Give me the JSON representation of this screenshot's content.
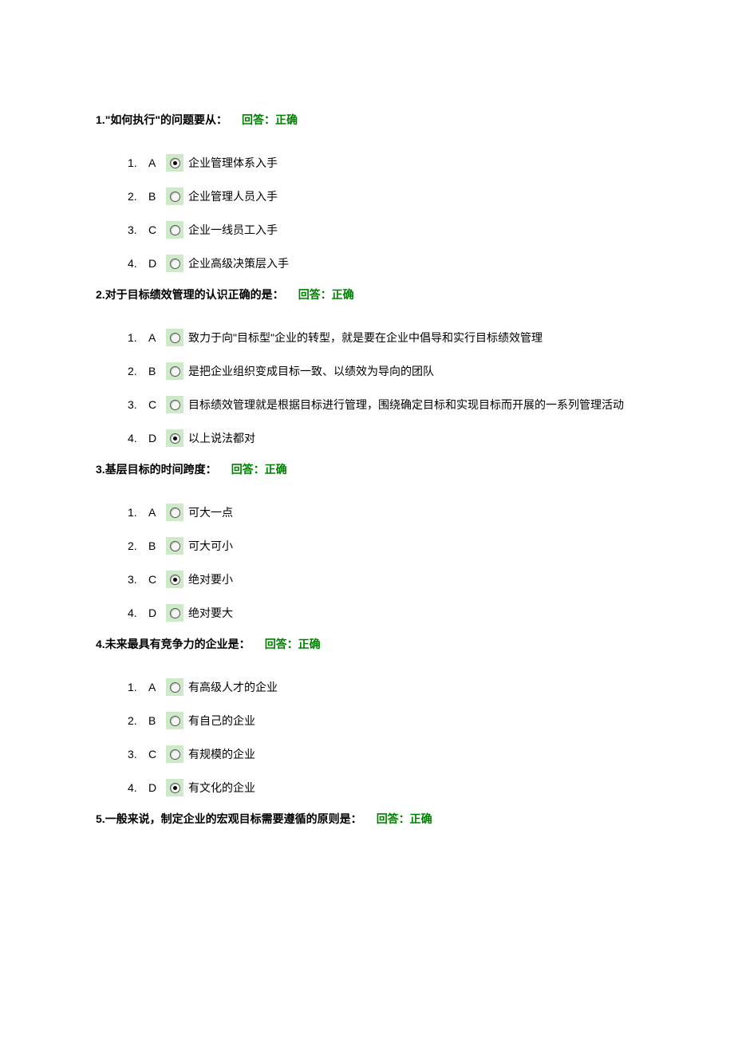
{
  "answer_label": "回答：正确",
  "questions": [
    {
      "num": "1.",
      "stem": "\"如何执行\"的问题要从：",
      "selected": 0,
      "options": [
        {
          "letter": "A",
          "text": "企业管理体系入手"
        },
        {
          "letter": "B",
          "text": "企业管理人员入手"
        },
        {
          "letter": "C",
          "text": "企业一线员工入手"
        },
        {
          "letter": "D",
          "text": "企业高级决策层入手"
        }
      ]
    },
    {
      "num": "2.",
      "stem": "对于目标绩效管理的认识正确的是：",
      "selected": 3,
      "options": [
        {
          "letter": "A",
          "text": "致力于向\"目标型\"企业的转型，就是要在企业中倡导和实行目标绩效管理"
        },
        {
          "letter": "B",
          "text": "是把企业组织变成目标一致、以绩效为导向的团队"
        },
        {
          "letter": "C",
          "text": "目标绩效管理就是根据目标进行管理，围绕确定目标和实现目标而开展的一系列管理活动"
        },
        {
          "letter": "D",
          "text": "以上说法都对"
        }
      ]
    },
    {
      "num": "3.",
      "stem": "基层目标的时间跨度：",
      "selected": 2,
      "options": [
        {
          "letter": "A",
          "text": "可大一点"
        },
        {
          "letter": "B",
          "text": "可大可小"
        },
        {
          "letter": "C",
          "text": "绝对要小"
        },
        {
          "letter": "D",
          "text": "绝对要大"
        }
      ]
    },
    {
      "num": "4.",
      "stem": "未来最具有竞争力的企业是：",
      "selected": 3,
      "options": [
        {
          "letter": "A",
          "text": "有高级人才的企业"
        },
        {
          "letter": "B",
          "text": "有自己的企业"
        },
        {
          "letter": "C",
          "text": "有规模的企业"
        },
        {
          "letter": "D",
          "text": "有文化的企业"
        }
      ]
    },
    {
      "num": "5.",
      "stem": "一般来说，制定企业的宏观目标需要遵循的原则是：",
      "selected": null,
      "options": []
    }
  ]
}
